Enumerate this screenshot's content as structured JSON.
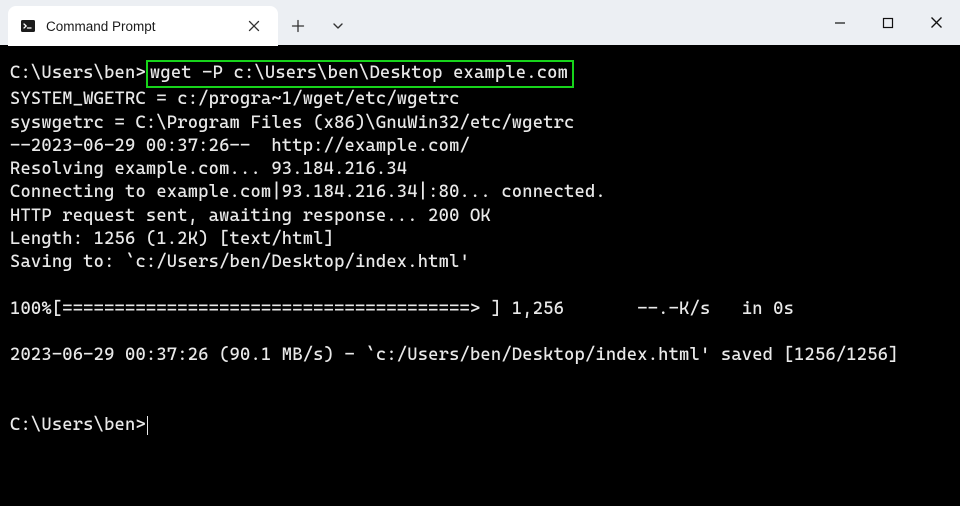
{
  "titlebar": {
    "tab_title": "Command Prompt"
  },
  "terminal": {
    "prompt1_path": "C:\\Users\\ben>",
    "cmd1": "wget -P c:\\Users\\ben\\Desktop example.com",
    "l2": "SYSTEM_WGETRC = c:/progra~1/wget/etc/wgetrc",
    "l3": "syswgetrc = C:\\Program Files (x86)\\GnuWin32/etc/wgetrc",
    "l4": "--2023-06-29 00:37:26--  http://example.com/",
    "l5": "Resolving example.com... 93.184.216.34",
    "l6": "Connecting to example.com|93.184.216.34|:80... connected.",
    "l7": "HTTP request sent, awaiting response... 200 OK",
    "l8": "Length: 1256 (1.2K) [text/html]",
    "l9": "Saving to: `c:/Users/ben/Desktop/index.html'",
    "l_blank": "",
    "l11": "100%[=======================================> ] 1,256       --.-K/s   in 0s",
    "l13": "2023-06-29 00:37:26 (90.1 MB/s) - `c:/Users/ben/Desktop/index.html' saved [1256/1256]",
    "prompt2_path": "C:\\Users\\ben>"
  }
}
